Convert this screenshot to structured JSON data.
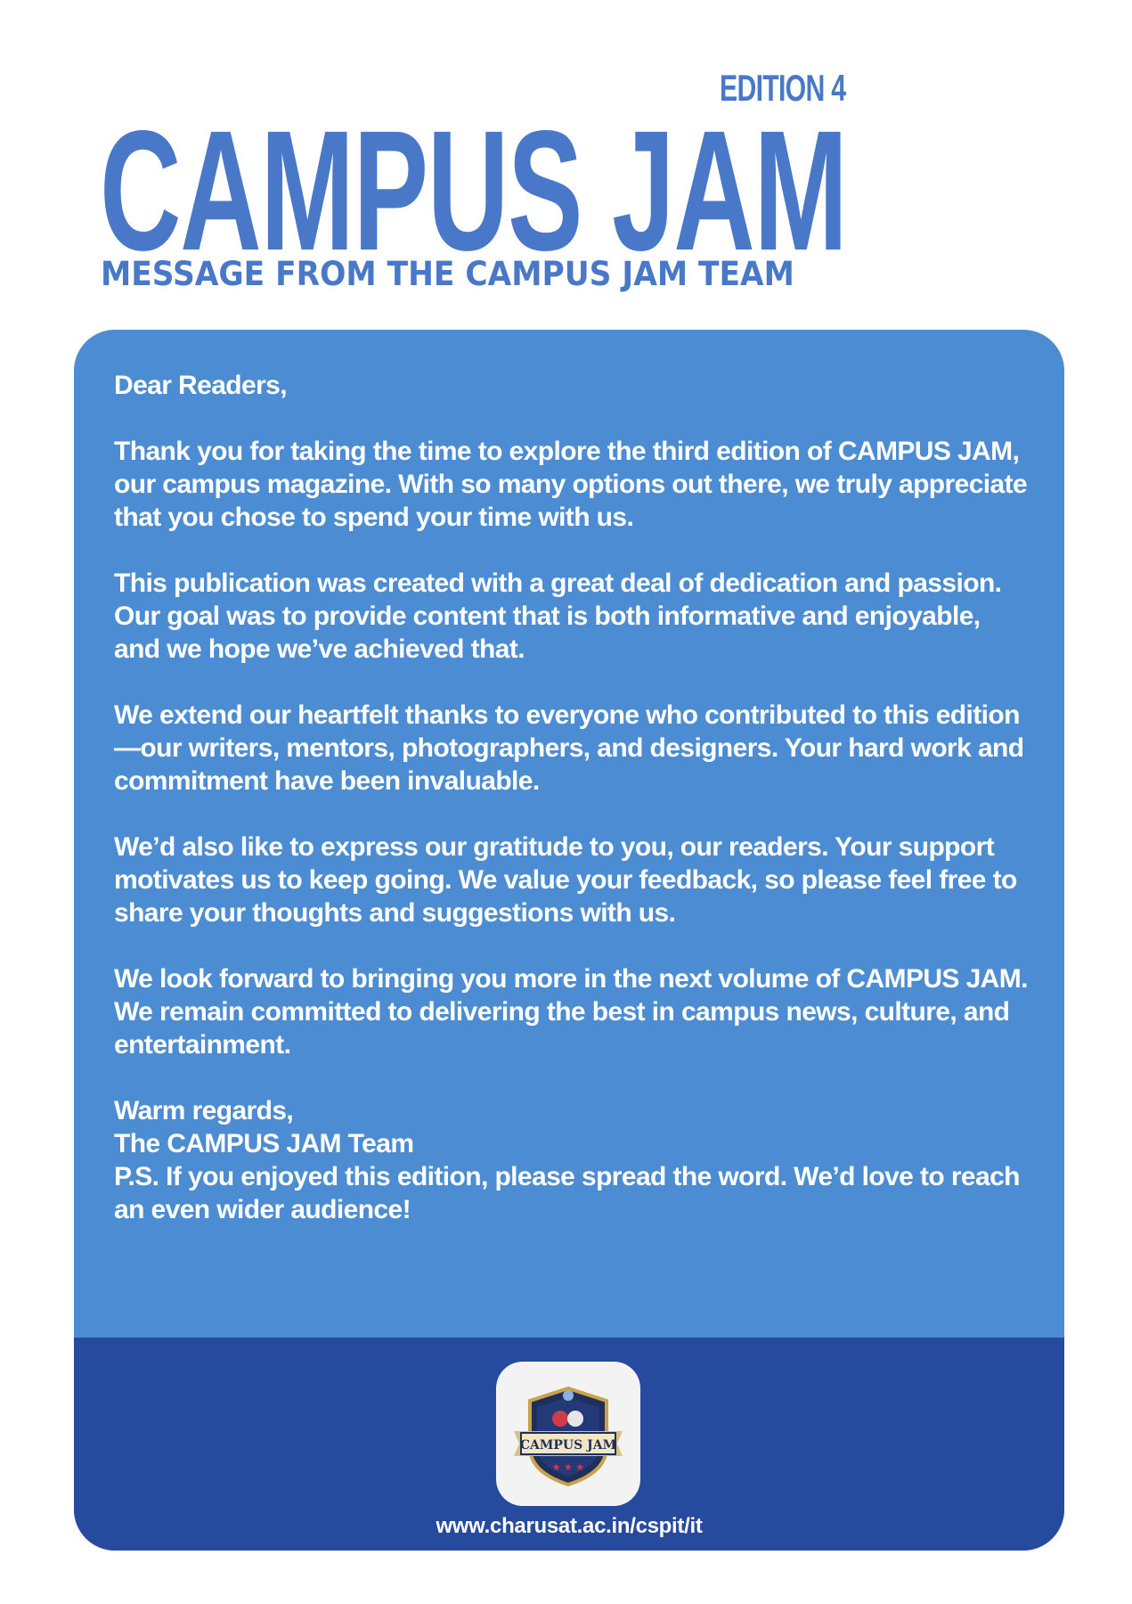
{
  "header": {
    "edition": "EDITION 4",
    "title": "CAMPUS JAM",
    "subtitle": "MESSAGE FROM THE CAMPUS JAM TEAM"
  },
  "letter": {
    "salutation": "Dear Readers,",
    "paragraphs": [
      "Thank you for taking the time to explore the third edition of CAMPUS JAM, our campus magazine. With so many options out there, we truly appreciate that you chose to spend your time with us.",
      "This publication was created with a great deal of dedication and passion. Our goal was to provide content that is both informative and enjoyable, and we hope we’ve achieved that.",
      "We extend our heartfelt thanks to everyone who contributed to this edition—our writers, mentors, photographers, and designers. Your hard work and commitment have been invaluable.",
      "We’d also like to express our gratitude to you, our readers. Your support motivates us to keep going. We value your feedback, so please feel free to share your thoughts and suggestions with us.",
      "We look forward to bringing you more in the next volume of CAMPUS JAM. We remain committed to delivering the best in campus news, culture, and entertainment."
    ],
    "closing": "Warm regards,",
    "signature": "The CAMPUS JAM Team",
    "postscript": "P.S. If you enjoyed this edition, please spread the word. We’d love to reach an even wider audience!"
  },
  "footer": {
    "logo_text": "CAMPUS JAM",
    "url": "www.charusat.ac.in/cspit/it"
  },
  "colors": {
    "title": "#4a78c8",
    "card": "#4b8cd2",
    "footer": "#254a9e"
  }
}
